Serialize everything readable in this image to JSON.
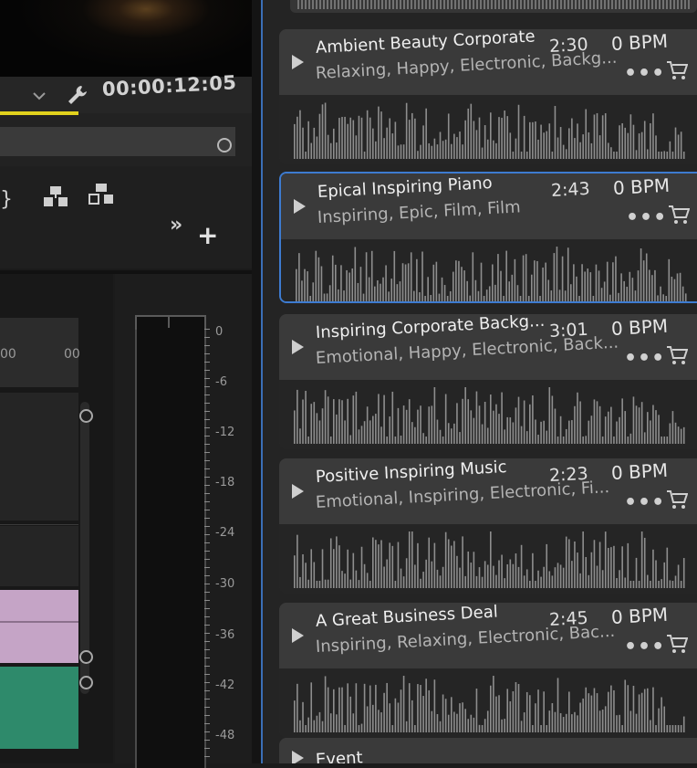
{
  "monitor": {
    "timecode": "00:00:12:05"
  },
  "timeline": {
    "ruler_labels": [
      "00",
      "00"
    ]
  },
  "meter": {
    "db_labels": [
      "0",
      "-6",
      "-12",
      "-18",
      "-24",
      "-30",
      "-36",
      "-42",
      "-48"
    ]
  },
  "icons": {
    "play": "play-icon",
    "more": "more-icon",
    "cart": "cart-icon",
    "wrench": "wrench-icon",
    "lift": "lift-icon",
    "extract": "extract-icon",
    "add": "plus-icon"
  },
  "colors": {
    "selection_accent": "#3d7bd0",
    "timeline_yellow": "#e1d11d",
    "clip_pink": "#c5a4c6",
    "clip_green": "#2e8a6b"
  },
  "controls": {
    "more_glyph": "»",
    "add_glyph": "+",
    "ellipsis": "•••"
  },
  "tracks": [
    {
      "title": "Ambient Beauty Corporate",
      "tags": "Relaxing, Happy, Electronic, Backg...",
      "duration": "2:30",
      "bpm": "0 BPM",
      "selected": false
    },
    {
      "title": "Epical Inspiring Piano",
      "tags": "Inspiring, Epic, Film, Film",
      "duration": "2:43",
      "bpm": "0 BPM",
      "selected": true
    },
    {
      "title": "Inspiring  Corporate Backg...",
      "tags": "Emotional, Happy, Electronic, Back...",
      "duration": "3:01",
      "bpm": "0 BPM",
      "selected": false
    },
    {
      "title": "Positive Inspiring Music",
      "tags": "Emotional, Inspiring, Electronic, Fi...",
      "duration": "2:23",
      "bpm": "0 BPM",
      "selected": false
    },
    {
      "title": "A Great Business Deal",
      "tags": "Inspiring, Relaxing, Electronic, Bac...",
      "duration": "2:45",
      "bpm": "0 BPM",
      "selected": false
    },
    {
      "title": "Event",
      "tags": "",
      "duration": "",
      "bpm": "",
      "selected": false
    }
  ]
}
